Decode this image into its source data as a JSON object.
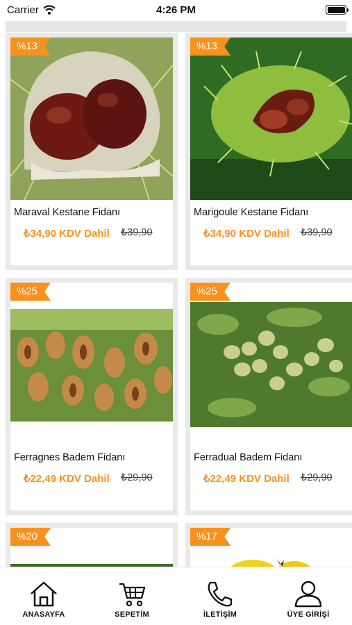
{
  "status_bar": {
    "carrier": "Carrier",
    "time": "4:26 PM"
  },
  "products": [
    {
      "badge": "%13",
      "name": "Maraval Kestane Fidanı",
      "price": "₺34,90 KDV Dahil",
      "old_price": "₺39,90",
      "image_icon": "chestnut-photo"
    },
    {
      "badge": "%13",
      "name": "Marigoule Kestane Fidanı",
      "price": "₺34,90 KDV Dahil",
      "old_price": "₺39,90",
      "image_icon": "chestnut-burr-photo"
    },
    {
      "badge": "%25",
      "name": "Ferragnes Badem Fidanı",
      "price": "₺22,49 KDV Dahil",
      "old_price": "₺29,90",
      "image_icon": "almond-photo"
    },
    {
      "badge": "%25",
      "name": "Ferradual Badem Fidanı",
      "price": "₺22,49 KDV Dahil",
      "old_price": "₺29,90",
      "image_icon": "almond-tree-photo"
    },
    {
      "badge": "%20",
      "image_icon": "tree-photo"
    },
    {
      "badge": "%17",
      "image_icon": "fruit-photo"
    }
  ],
  "tabs": [
    {
      "label": "ANASAYFA",
      "icon": "home-icon"
    },
    {
      "label": "SEPETİM",
      "icon": "cart-icon"
    },
    {
      "label": "İLETİŞİM",
      "icon": "phone-icon"
    },
    {
      "label": "ÜYE GİRİŞİ",
      "icon": "user-icon"
    }
  ],
  "colors": {
    "accent": "#f7921e",
    "card_border": "#e9e9e9",
    "text": "#111111"
  }
}
